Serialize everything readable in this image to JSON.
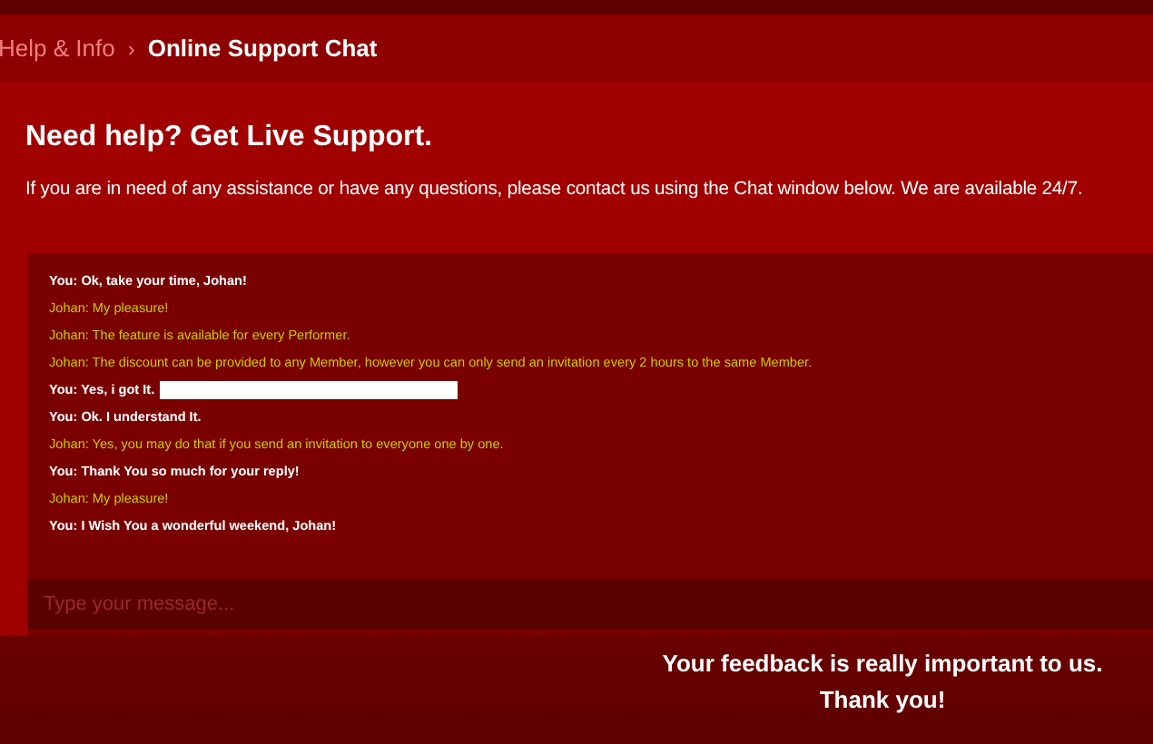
{
  "breadcrumb": {
    "parent": "Help & Info",
    "separator": "›",
    "current": "Online Support Chat"
  },
  "heading": "Need help? Get Live Support.",
  "intro": "If you are in need of any assistance or have any questions, please contact us using the Chat window below. We are available 24/7.",
  "messages": [
    {
      "kind": "you",
      "text": "You: Ok, take your time, Johan!"
    },
    {
      "kind": "agent",
      "text": "Johan: My pleasure!"
    },
    {
      "kind": "agent",
      "text": "Johan: The feature is available for every Performer."
    },
    {
      "kind": "agent",
      "text": "Johan: The discount can be provided to any Member, however you can only send an invitation every 2 hours to the same Member."
    },
    {
      "kind": "you",
      "text": "You: Yes, i got It.",
      "redacted": true
    },
    {
      "kind": "you",
      "text": "You: Ok. I understand It."
    },
    {
      "kind": "agent",
      "text": "Johan: Yes, you may do that if you send an invitation to everyone one by one."
    },
    {
      "kind": "you",
      "text": "You: Thank You so much for your reply!"
    },
    {
      "kind": "agent",
      "text": "Johan: My pleasure!"
    },
    {
      "kind": "you",
      "text": "You: I Wish You a wonderful weekend, Johan!"
    }
  ],
  "message_input": {
    "placeholder": "Type your message..."
  },
  "footer": [
    "Your feedback is really important to us.",
    "Thank you!"
  ]
}
